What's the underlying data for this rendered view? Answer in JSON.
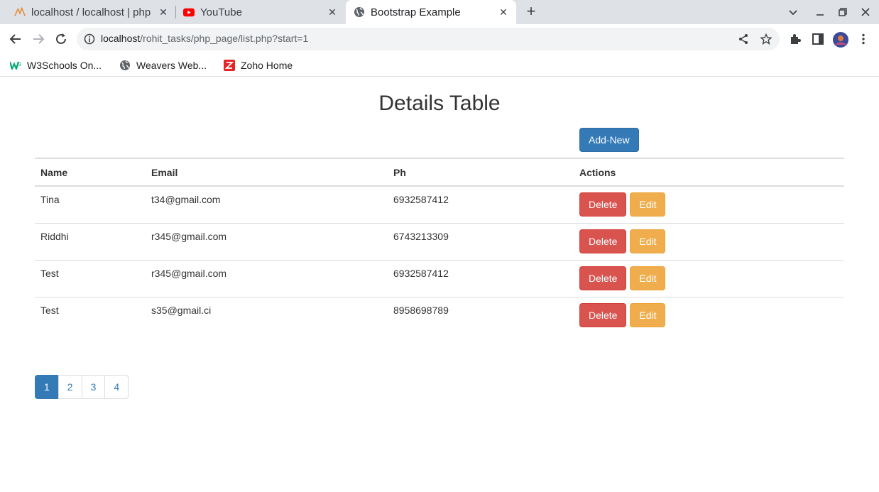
{
  "browser": {
    "tabs": [
      {
        "title": "localhost / localhost | php",
        "icon": "phpmyadmin-icon"
      },
      {
        "title": "YouTube",
        "icon": "youtube-icon"
      },
      {
        "title": "Bootstrap Example",
        "icon": "globe-icon",
        "active": true
      }
    ],
    "url": {
      "host": "localhost",
      "path": "/rohit_tasks/php_page/list.php?start=1"
    },
    "bookmarks": [
      {
        "label": "W3Schools On...",
        "icon": "w3schools-icon"
      },
      {
        "label": "Weavers Web...",
        "icon": "globe-icon"
      },
      {
        "label": "Zoho Home",
        "icon": "zoho-icon"
      }
    ]
  },
  "page": {
    "title": "Details Table",
    "add_button": "Add-New",
    "table": {
      "headers": [
        "Name",
        "Email",
        "Ph",
        "Actions"
      ],
      "rows": [
        {
          "name": "Tina",
          "email": "t34@gmail.com",
          "ph": "6932587412"
        },
        {
          "name": "Riddhi",
          "email": "r345@gmail.com",
          "ph": "6743213309"
        },
        {
          "name": "Test",
          "email": "r345@gmail.com",
          "ph": "6932587412"
        },
        {
          "name": "Test",
          "email": "s35@gmail.ci",
          "ph": "8958698789"
        }
      ],
      "delete_label": "Delete",
      "edit_label": "Edit"
    },
    "pagination": [
      "1",
      "2",
      "3",
      "4"
    ],
    "current_page": "1"
  },
  "colors": {
    "primary": "#337ab7",
    "danger": "#d9534f",
    "warning": "#f0ad4e"
  }
}
